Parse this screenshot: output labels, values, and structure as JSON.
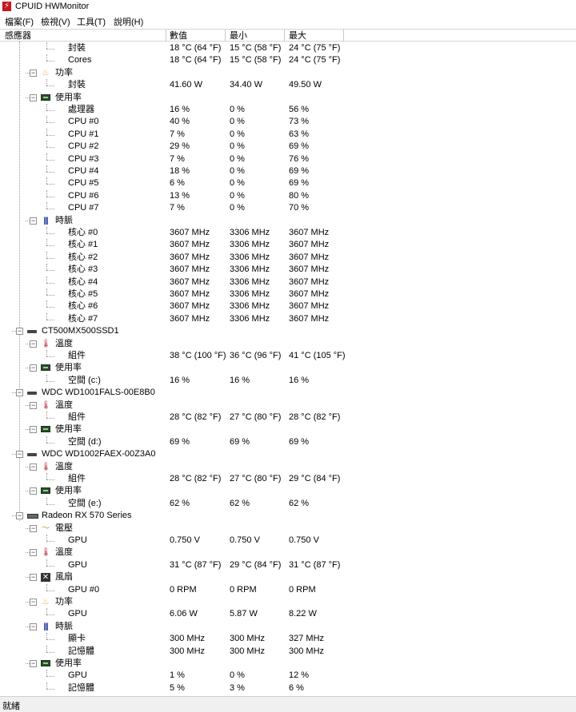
{
  "app": {
    "title": "CPUID HWMonitor",
    "icon_glyph": "⚡",
    "accent_color": "#c8171d"
  },
  "menu": [
    "檔案(F)",
    "檢視(V)",
    "工具(T)",
    "說明(H)"
  ],
  "columns": [
    "感應器",
    "數值",
    "最小",
    "最大"
  ],
  "status": "就緒",
  "rows": [
    {
      "depth": 3,
      "label": "封裝",
      "value": "18 °C (64 °F)",
      "min": "15 °C (58 °F)",
      "max": "24 °C (75 °F)"
    },
    {
      "depth": 3,
      "label": "Cores",
      "value": "18 °C (64 °F)",
      "min": "15 °C (58 °F)",
      "max": "24 °C (75 °F)"
    },
    {
      "depth": 2,
      "label": "功率",
      "icon": "power-icon"
    },
    {
      "depth": 3,
      "label": "封裝",
      "value": "41.60 W",
      "min": "34.40 W",
      "max": "49.50 W"
    },
    {
      "depth": 2,
      "label": "使用率",
      "icon": "usage-icon"
    },
    {
      "depth": 3,
      "label": "處理器",
      "value": "16 %",
      "min": "0 %",
      "max": "56 %"
    },
    {
      "depth": 3,
      "label": "CPU #0",
      "value": "40 %",
      "min": "0 %",
      "max": "73 %"
    },
    {
      "depth": 3,
      "label": "CPU #1",
      "value": "7 %",
      "min": "0 %",
      "max": "63 %"
    },
    {
      "depth": 3,
      "label": "CPU #2",
      "value": "29 %",
      "min": "0 %",
      "max": "69 %"
    },
    {
      "depth": 3,
      "label": "CPU #3",
      "value": "7 %",
      "min": "0 %",
      "max": "76 %"
    },
    {
      "depth": 3,
      "label": "CPU #4",
      "value": "18 %",
      "min": "0 %",
      "max": "69 %"
    },
    {
      "depth": 3,
      "label": "CPU #5",
      "value": "6 %",
      "min": "0 %",
      "max": "69 %"
    },
    {
      "depth": 3,
      "label": "CPU #6",
      "value": "13 %",
      "min": "0 %",
      "max": "80 %"
    },
    {
      "depth": 3,
      "label": "CPU #7",
      "value": "7 %",
      "min": "0 %",
      "max": "70 %"
    },
    {
      "depth": 2,
      "label": "時脈",
      "icon": "clock-icon"
    },
    {
      "depth": 3,
      "label": "核心 #0",
      "value": "3607 MHz",
      "min": "3306 MHz",
      "max": "3607 MHz"
    },
    {
      "depth": 3,
      "label": "核心 #1",
      "value": "3607 MHz",
      "min": "3306 MHz",
      "max": "3607 MHz"
    },
    {
      "depth": 3,
      "label": "核心 #2",
      "value": "3607 MHz",
      "min": "3306 MHz",
      "max": "3607 MHz"
    },
    {
      "depth": 3,
      "label": "核心 #3",
      "value": "3607 MHz",
      "min": "3306 MHz",
      "max": "3607 MHz"
    },
    {
      "depth": 3,
      "label": "核心 #4",
      "value": "3607 MHz",
      "min": "3306 MHz",
      "max": "3607 MHz"
    },
    {
      "depth": 3,
      "label": "核心 #5",
      "value": "3607 MHz",
      "min": "3306 MHz",
      "max": "3607 MHz"
    },
    {
      "depth": 3,
      "label": "核心 #6",
      "value": "3607 MHz",
      "min": "3306 MHz",
      "max": "3607 MHz"
    },
    {
      "depth": 3,
      "label": "核心 #7",
      "value": "3607 MHz",
      "min": "3306 MHz",
      "max": "3607 MHz"
    },
    {
      "depth": 1,
      "label": "CT500MX500SSD1",
      "icon": "drive-icon"
    },
    {
      "depth": 2,
      "label": "溫度",
      "icon": "thermometer-icon"
    },
    {
      "depth": 3,
      "label": "組件",
      "value": "38 °C (100 °F)",
      "min": "36 °C (96 °F)",
      "max": "41 °C (105 °F)"
    },
    {
      "depth": 2,
      "label": "使用率",
      "icon": "usage-icon"
    },
    {
      "depth": 3,
      "label": "空間 (c:)",
      "value": "16 %",
      "min": "16 %",
      "max": "16 %"
    },
    {
      "depth": 1,
      "label": "WDC WD1001FALS-00E8B0",
      "icon": "drive-icon"
    },
    {
      "depth": 2,
      "label": "溫度",
      "icon": "thermometer-icon"
    },
    {
      "depth": 3,
      "label": "組件",
      "value": "28 °C (82 °F)",
      "min": "27 °C (80 °F)",
      "max": "28 °C (82 °F)"
    },
    {
      "depth": 2,
      "label": "使用率",
      "icon": "usage-icon"
    },
    {
      "depth": 3,
      "label": "空間 (d:)",
      "value": "69 %",
      "min": "69 %",
      "max": "69 %"
    },
    {
      "depth": 1,
      "label": "WDC WD1002FAEX-00Z3A0",
      "icon": "drive-icon"
    },
    {
      "depth": 2,
      "label": "溫度",
      "icon": "thermometer-icon"
    },
    {
      "depth": 3,
      "label": "組件",
      "value": "28 °C (82 °F)",
      "min": "27 °C (80 °F)",
      "max": "29 °C (84 °F)"
    },
    {
      "depth": 2,
      "label": "使用率",
      "icon": "usage-icon"
    },
    {
      "depth": 3,
      "label": "空間 (e:)",
      "value": "62 %",
      "min": "62 %",
      "max": "62 %"
    },
    {
      "depth": 1,
      "label": "Radeon RX 570 Series",
      "icon": "gpu-icon"
    },
    {
      "depth": 2,
      "label": "電壓",
      "icon": "voltage-icon"
    },
    {
      "depth": 3,
      "label": "GPU",
      "value": "0.750 V",
      "min": "0.750 V",
      "max": "0.750 V"
    },
    {
      "depth": 2,
      "label": "溫度",
      "icon": "thermometer-icon"
    },
    {
      "depth": 3,
      "label": "GPU",
      "value": "31 °C (87 °F)",
      "min": "29 °C (84 °F)",
      "max": "31 °C (87 °F)"
    },
    {
      "depth": 2,
      "label": "風扇",
      "icon": "fan-icon"
    },
    {
      "depth": 3,
      "label": "GPU #0",
      "value": "0 RPM",
      "min": "0 RPM",
      "max": "0 RPM"
    },
    {
      "depth": 2,
      "label": "功率",
      "icon": "power-icon"
    },
    {
      "depth": 3,
      "label": "GPU",
      "value": "6.06 W",
      "min": "5.87 W",
      "max": "8.22 W"
    },
    {
      "depth": 2,
      "label": "時脈",
      "icon": "clock-icon"
    },
    {
      "depth": 3,
      "label": "顯卡",
      "value": "300 MHz",
      "min": "300 MHz",
      "max": "327 MHz"
    },
    {
      "depth": 3,
      "label": "記憶體",
      "value": "300 MHz",
      "min": "300 MHz",
      "max": "300 MHz"
    },
    {
      "depth": 2,
      "label": "使用率",
      "icon": "usage-icon"
    },
    {
      "depth": 3,
      "label": "GPU",
      "value": "1 %",
      "min": "0 %",
      "max": "12 %"
    },
    {
      "depth": 3,
      "label": "記憶體",
      "value": "5 %",
      "min": "3 %",
      "max": "6 %"
    }
  ]
}
